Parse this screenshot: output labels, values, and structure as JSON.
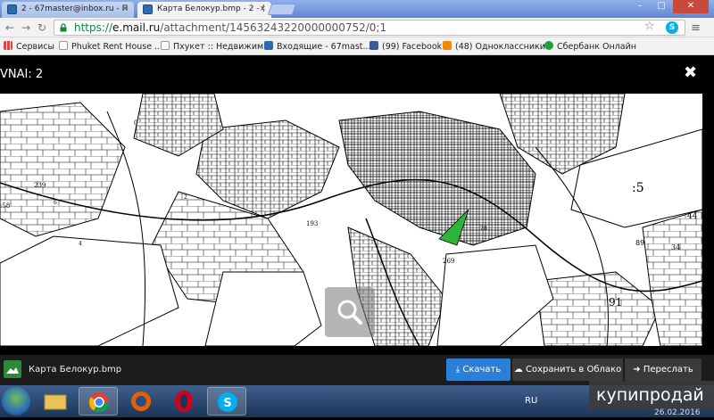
{
  "browser": {
    "tabs": [
      {
        "title": "2 - 67master@inbox.ru - П",
        "active": false
      },
      {
        "title": "Карта Белокур.bmp - 2 - (",
        "active": true
      }
    ],
    "url": {
      "scheme": "https://",
      "host": "e.mail.ru",
      "path": "/attachment/14563243220000000752/0;1"
    },
    "bookmarks": [
      {
        "label": "Сервисы",
        "icon": "apps-grid-icon"
      },
      {
        "label": "Phuket Rent House ...",
        "icon": "page-icon"
      },
      {
        "label": "Пхукет :: Недвижим...",
        "icon": "page-icon"
      },
      {
        "label": "Входящие - 67mast...",
        "icon": "mail-icon"
      },
      {
        "label": "(99) Facebook",
        "icon": "facebook-icon"
      },
      {
        "label": "(48) Одноклассники",
        "icon": "odnoklassniki-icon"
      },
      {
        "label": "Сбербанк Онлайн",
        "icon": "sberbank-icon"
      }
    ]
  },
  "viewer": {
    "title": "VNAI: 2",
    "close": "✖",
    "file_name": "Карта Белокур.bmp",
    "buttons": {
      "download": "Скачать",
      "save_cloud": "Сохранить в Облако",
      "forward": "Переслать"
    },
    "map_labels": [
      "239",
      ":5",
      "193",
      "44",
      "89",
      "34",
      "91",
      "28",
      "269",
      "4",
      "6",
      "2",
      "0",
      ":58"
    ]
  },
  "taskbar": {
    "language": "RU",
    "date": "26.02.2016"
  },
  "watermark": "купипродай",
  "colors": {
    "accent_blue": "#2b7fd8",
    "parcel_green": "#2fb53a",
    "viewer_bg": "#000000"
  }
}
